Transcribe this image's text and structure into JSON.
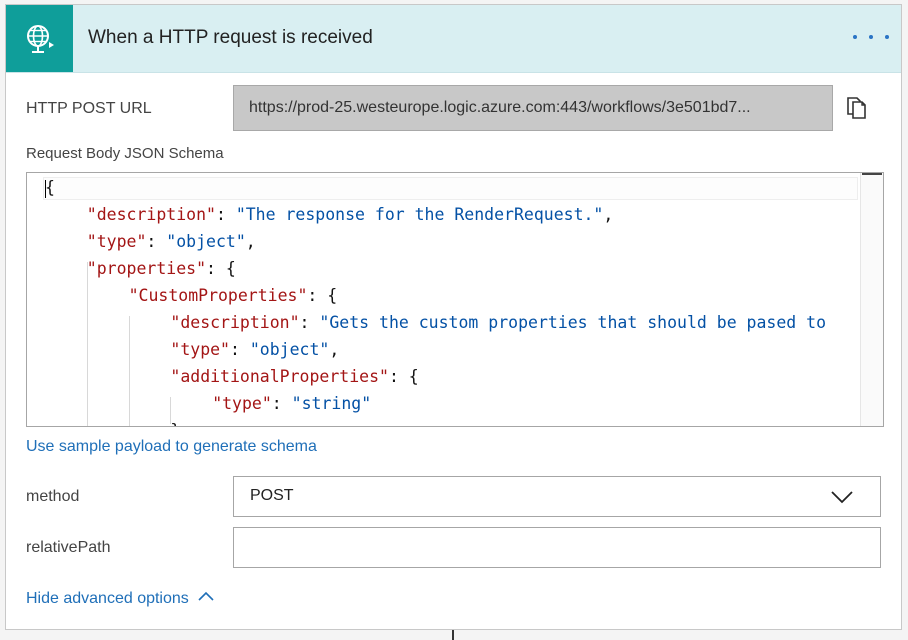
{
  "header": {
    "title": "When a HTTP request is received",
    "icon": "globe-request-icon",
    "menu_icon": "ellipsis-icon",
    "accent_color": "#0f9e9a",
    "background_color": "#d9eff2"
  },
  "http_post_url": {
    "label": "HTTP POST URL",
    "value": "https://prod-25.westeurope.logic.azure.com:443/workflows/3e501bd7...",
    "copy_icon": "copy-icon"
  },
  "schema": {
    "label": "Request Body JSON Schema",
    "lines": [
      {
        "indent": 0,
        "tokens": [
          {
            "t": "p",
            "v": "{"
          }
        ]
      },
      {
        "indent": 1,
        "tokens": [
          {
            "t": "k",
            "v": "\"description\""
          },
          {
            "t": "p",
            "v": ": "
          },
          {
            "t": "s",
            "v": "\"The response for the RenderRequest.\""
          },
          {
            "t": "p",
            "v": ","
          }
        ]
      },
      {
        "indent": 1,
        "tokens": [
          {
            "t": "k",
            "v": "\"type\""
          },
          {
            "t": "p",
            "v": ": "
          },
          {
            "t": "s",
            "v": "\"object\""
          },
          {
            "t": "p",
            "v": ","
          }
        ]
      },
      {
        "indent": 1,
        "tokens": [
          {
            "t": "k",
            "v": "\"properties\""
          },
          {
            "t": "p",
            "v": ": {"
          }
        ]
      },
      {
        "indent": 2,
        "tokens": [
          {
            "t": "k",
            "v": "\"CustomProperties\""
          },
          {
            "t": "p",
            "v": ": {"
          }
        ]
      },
      {
        "indent": 3,
        "tokens": [
          {
            "t": "k",
            "v": "\"description\""
          },
          {
            "t": "p",
            "v": ": "
          },
          {
            "t": "s",
            "v": "\"Gets the custom properties that should be pased to"
          }
        ]
      },
      {
        "indent": 3,
        "tokens": [
          {
            "t": "k",
            "v": "\"type\""
          },
          {
            "t": "p",
            "v": ": "
          },
          {
            "t": "s",
            "v": "\"object\""
          },
          {
            "t": "p",
            "v": ","
          }
        ]
      },
      {
        "indent": 3,
        "tokens": [
          {
            "t": "k",
            "v": "\"additionalProperties\""
          },
          {
            "t": "p",
            "v": ": {"
          }
        ]
      },
      {
        "indent": 4,
        "tokens": [
          {
            "t": "k",
            "v": "\"type\""
          },
          {
            "t": "p",
            "v": ": "
          },
          {
            "t": "s",
            "v": "\"string\""
          }
        ]
      },
      {
        "indent": 3,
        "tokens": [
          {
            "t": "p",
            "v": "}"
          }
        ]
      }
    ]
  },
  "sample_payload_link": "Use sample payload to generate schema",
  "method": {
    "label": "method",
    "value": "POST",
    "chevron_icon": "chevron-down-icon"
  },
  "relative_path": {
    "label": "relativePath",
    "value": "",
    "placeholder": ""
  },
  "advanced_options": {
    "label": "Hide advanced options",
    "chevron_icon": "chevron-up-icon"
  },
  "colors": {
    "link": "#1f6fb8",
    "key": "#a31515",
    "string": "#0451a5"
  }
}
